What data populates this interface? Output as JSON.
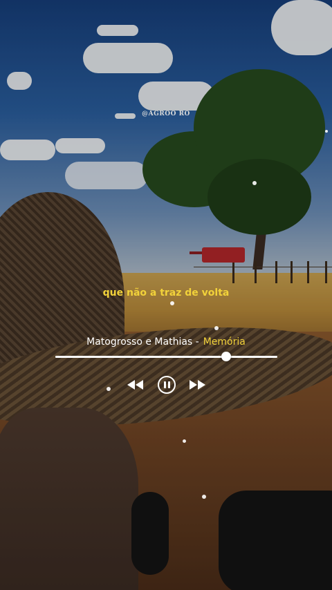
{
  "watermark": "@AGROO RO",
  "lyric": "que não a traz de volta",
  "player": {
    "artist": "Matogrosso e Mathias -",
    "title": "Memória",
    "progress": 0.77,
    "controls": {
      "previous_icon": "rewind-icon",
      "pause_icon": "pause-icon",
      "next_icon": "fast-forward-icon"
    }
  },
  "colors": {
    "lyric": "#f2d23a",
    "title": "#f2d23a",
    "artist": "#ffffff",
    "progress": "#ffffff"
  }
}
